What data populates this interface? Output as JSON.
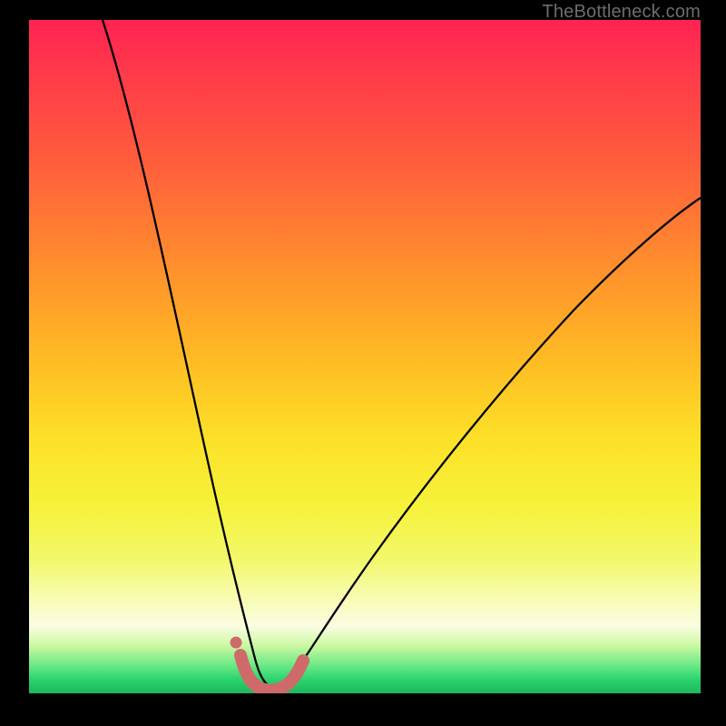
{
  "watermark": "TheBottleneck.com",
  "colors": {
    "frame": "#000000",
    "curve": "#000000",
    "marker": "#cf6a6a",
    "grad_top": "#ff2352",
    "grad_bottom": "#1fb65a"
  },
  "chart_data": {
    "type": "line",
    "title": "",
    "xlabel": "",
    "ylabel": "",
    "xlim": [
      0,
      100
    ],
    "ylim": [
      0,
      100
    ],
    "series": [
      {
        "name": "bottleneck-curve",
        "x": [
          11,
          13,
          15,
          17,
          19,
          21,
          23,
          25,
          27,
          29,
          30,
          31,
          32,
          33,
          34,
          35,
          36,
          37,
          39,
          42,
          46,
          50,
          55,
          60,
          66,
          72,
          78,
          85,
          92,
          100
        ],
        "y": [
          100,
          90,
          80,
          71,
          62,
          53,
          45,
          37,
          29,
          21,
          17,
          13,
          9,
          5,
          3,
          2,
          2,
          3,
          6,
          11,
          18,
          24,
          31,
          38,
          45,
          51,
          57,
          63,
          68,
          73
        ]
      },
      {
        "name": "markers",
        "x": [
          30.5,
          31.3,
          33.0,
          35.0,
          36.5,
          37.4
        ],
        "y": [
          7.0,
          4.5,
          2.0,
          2.0,
          4.0,
          7.0
        ]
      }
    ],
    "annotations": [
      {
        "text": "TheBottleneck.com",
        "pos": "top-right"
      }
    ]
  }
}
